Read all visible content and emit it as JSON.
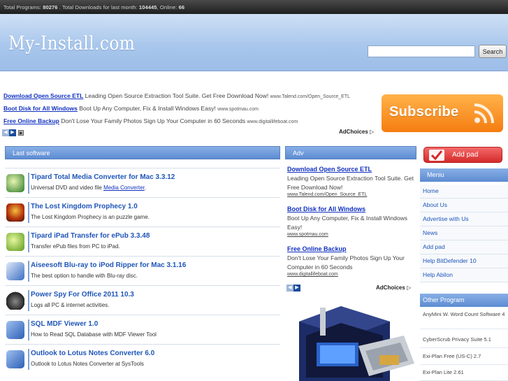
{
  "topbar": {
    "programs_label": "Total Programs:",
    "programs_value": "80276",
    "downloads_label": ". Total Downloads for last month:",
    "downloads_value": "104445",
    "online_label": ", Online:",
    "online_value": "66"
  },
  "header": {
    "logo": "My-Install.com",
    "search_placeholder": "",
    "search_button": "Search"
  },
  "top_ads": [
    {
      "title": "Download Open Source ETL",
      "text": "Leading Open Source Extraction Tool Suite. Get Free Download Now!",
      "url": "www.Talend.com/Open_Source_ETL"
    },
    {
      "title": "Boot Disk for All Windows",
      "text": "Boot Up Any Computer, Fix & Install Windows Easy!",
      "url": "www.spotmau.com"
    },
    {
      "title": "Free Online Backup",
      "text": "Don't Lose Your Family Photos Sign Up Your Computer in 60 Seconds",
      "url": "www.digitallifeboat.com"
    }
  ],
  "adchoices": "AdChoices",
  "subscribe": {
    "label": "Subscribe",
    "icon": "rss-icon"
  },
  "last_software": {
    "heading": "Last software",
    "items": [
      {
        "title": "Tipard Total Media Converter for Mac 3.3.12",
        "desc": "Universal DVD and video file",
        "desc_link": "Media Converter",
        "desc_tail": ".",
        "icon": "media-converter-icon",
        "color": "#2c7a2c"
      },
      {
        "title": "The Lost Kingdom Prophecy 1.0",
        "desc": "The Lost Kingdom Prophecy is an puzzle game.",
        "desc_link": "",
        "desc_tail": "",
        "icon": "game-icon",
        "color": "#b3300a"
      },
      {
        "title": "Tipard iPad Transfer for ePub 3.3.48",
        "desc": "Transfer ePub files from PC to iPad.",
        "desc_link": "",
        "desc_tail": "",
        "icon": "epub-transfer-icon",
        "color": "#5a9a1a"
      },
      {
        "title": "Aiseesoft Blu-ray to iPod Ripper for Mac 3.1.16",
        "desc": "The best option to handle with Blu-ray disc.",
        "desc_link": "",
        "desc_tail": "",
        "icon": "bluray-ripper-icon",
        "color": "#3b6fc4"
      },
      {
        "title": "Power Spy For Office 2011 10.3",
        "desc": "Logs all PC & internet activities.",
        "desc_link": "",
        "desc_tail": "",
        "icon": "spy-icon",
        "color": "#444444"
      },
      {
        "title": "SQL MDF Viewer 1.0",
        "desc": "How to Read SQL Database with MDF Viewer Tool",
        "desc_link": "",
        "desc_tail": "",
        "icon": "sql-viewer-icon",
        "color": "#2d5fb5"
      },
      {
        "title": "Outlook to Lotus Notes Converter 6.0",
        "desc": "Outlook to Lotus Notes Converter at SysTools",
        "desc_link": "",
        "desc_tail": "",
        "icon": "outlook-converter-icon",
        "color": "#2d5fb5"
      }
    ]
  },
  "adv": {
    "heading": "Adv",
    "ads": [
      {
        "title": "Download Open Source ETL",
        "text": "Leading Open Source Extraction Tool Suite. Get Free Download Now!",
        "url": "www.Talend.com/Open_Source_ETL"
      },
      {
        "title": "Boot Disk for All Windows",
        "text": "Boot Up Any Computer, Fix & Install Windows Easy!",
        "url": "www.spotmau.com"
      },
      {
        "title": "Free Online Backup",
        "text": "Don't Lose Your Family Photos Sign Up Your Computer in 60 Seconds",
        "url": "www.digitallifeboat.com"
      }
    ]
  },
  "sidebar": {
    "add_pad_button": "Add pad",
    "menu_heading": "Meniu",
    "menu": [
      "Home",
      "About Us",
      "Advertise with Us",
      "News",
      "Add pad",
      "Help BitDefender 10",
      "Help Abilon"
    ],
    "other_heading": "Other Program",
    "other": [
      "AnyMini W. Word Count Software 4",
      "CyberScrub Privacy Suite 5.1",
      "Exi-Plan Free (US-C) 2.7",
      "Exi-Plan Lite 2.61"
    ]
  },
  "colors": {
    "accent": "#5d8bd2",
    "link": "#1f56b8",
    "subscribe": "#f57d10",
    "add_pad": "#d42a2a"
  }
}
